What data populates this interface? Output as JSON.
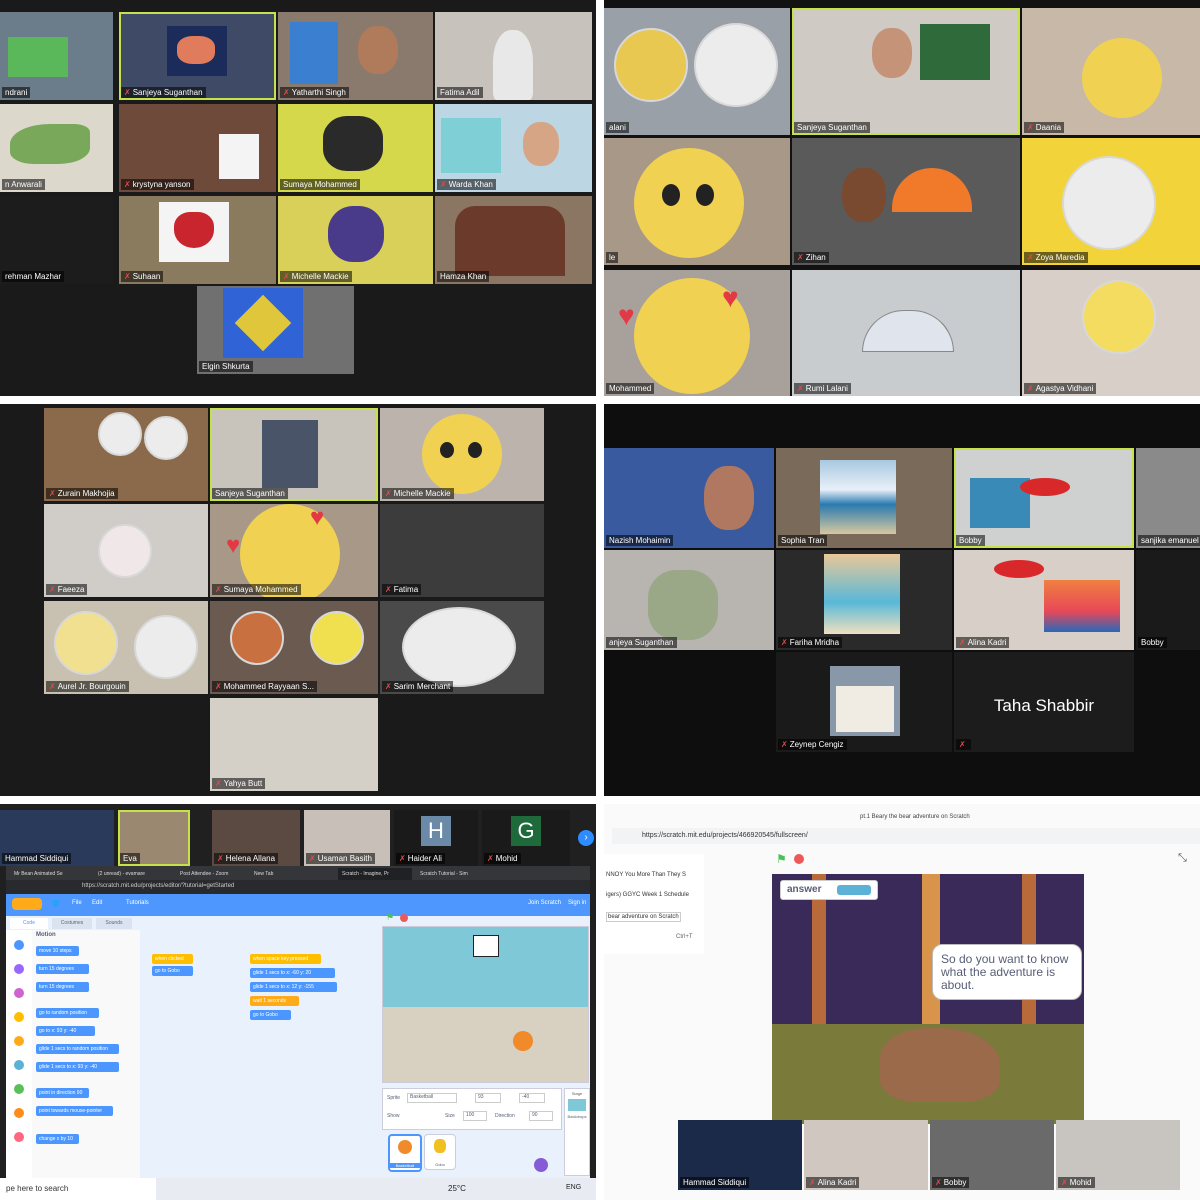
{
  "panel1": {
    "participants": [
      {
        "name": "ndrani"
      },
      {
        "name": "Sanjeya Suganthan"
      },
      {
        "name": "Yatharthi Singh"
      },
      {
        "name": "Fatima Adil"
      },
      {
        "name": "n Anwarali"
      },
      {
        "name": "krystyna yanson"
      },
      {
        "name": "Sumaya Mohammed"
      },
      {
        "name": "Warda Khan"
      },
      {
        "name": "rehman Mazhar"
      },
      {
        "name": "Suhaan"
      },
      {
        "name": "Michelle Mackie"
      },
      {
        "name": "Hamza Khan"
      },
      {
        "name": "Elgin Shkurta"
      }
    ]
  },
  "panel2": {
    "participants": [
      {
        "name": "alani"
      },
      {
        "name": "Sanjeya Suganthan"
      },
      {
        "name": "Daania"
      },
      {
        "name": "le"
      },
      {
        "name": "Zihan"
      },
      {
        "name": "Zoya Maredia"
      },
      {
        "name": "Mohammed"
      },
      {
        "name": "Rumi Lalani"
      },
      {
        "name": "Agastya Vidhani"
      }
    ]
  },
  "panel3": {
    "participants": [
      {
        "name": "Zurain Makhojia"
      },
      {
        "name": "Sanjeya Suganthan"
      },
      {
        "name": "Michelle Mackie"
      },
      {
        "name": "Faeeza"
      },
      {
        "name": "Sumaya Mohammed"
      },
      {
        "name": "Fatima"
      },
      {
        "name": "Aurel Jr. Bourgouin"
      },
      {
        "name": "Mohammed Rayyaan S..."
      },
      {
        "name": "Sarim Merchant"
      },
      {
        "name": "Yahya Butt"
      }
    ]
  },
  "panel4": {
    "participants": [
      {
        "name": "Nazish Mohaimin"
      },
      {
        "name": "Sophia Tran"
      },
      {
        "name": "Bobby"
      },
      {
        "name": "sanjika emanuel su"
      },
      {
        "name": "anjeya Suganthan"
      },
      {
        "name": "Fariha Mridha"
      },
      {
        "name": "Alina Kadri"
      },
      {
        "name": "Bobby"
      },
      {
        "name": "Zeynep Cengiz"
      },
      {
        "name": ""
      }
    ],
    "big_name": "Taha Shabbir"
  },
  "panel5": {
    "participants": [
      {
        "name": "Hammad Siddiqui"
      },
      {
        "name": "Eva"
      },
      {
        "name": "Helena Allana"
      },
      {
        "name": "Usaman Basith"
      },
      {
        "name": "Haider Ali",
        "initial": "H"
      },
      {
        "name": "Mohid",
        "initial": "G"
      }
    ],
    "browser_tabs": [
      "Mr Bean Animated Se",
      "(2 unread) - evamare",
      "Post Attendee - Zoom",
      "New Tab",
      "Scratch - Imagine, Pr",
      "Scratch Tutorial - Sim"
    ],
    "url": "https://scratch.mit.edu/projects/editor/?tutorial=getStarted",
    "menu": [
      "File",
      "Edit",
      "Tutorials",
      "Join Scratch",
      "Sign in"
    ],
    "editor_tabs": [
      "Code",
      "Costumes",
      "Sounds"
    ],
    "category_title": "Motion",
    "categories": [
      "Motion",
      "Looks",
      "Sound",
      "Events",
      "Control",
      "Sensing",
      "Operators",
      "Variables",
      "My Blocks"
    ],
    "palette_blocks": [
      "move 10 steps",
      "turn 15 degrees",
      "turn 15 degrees",
      "go to random position",
      "go to x: 93 y: -40",
      "glide 1 secs to random position",
      "glide 1 secs to x: 93 y: -40",
      "point in direction 90",
      "point towards mouse-pointer",
      "change x by 10"
    ],
    "script1": [
      "when clicked",
      "go to Gobo"
    ],
    "script2": [
      "when space key pressed",
      "glide 1 secs to x: -60 y: 20",
      "glide 1 secs to x: 12 y: -155",
      "wait 1 seconds",
      "go to Gobo"
    ],
    "sprite_info": {
      "sprite_label": "Sprite",
      "sprite_name": "Basketball",
      "x": "93",
      "y": "-40",
      "show_label": "Show",
      "size_label": "Size",
      "size": "100",
      "direction_label": "Direction",
      "direction": "90"
    },
    "sprites": [
      "Basketball",
      "Gobo"
    ],
    "stage_label": "Stage",
    "backdrops_label": "Backdrops",
    "taskbar_search": "pe here to search",
    "weather": "25°C",
    "lang": "ENG"
  },
  "panel6": {
    "tab_title": "pt.1 Beary the bear adventure on Scratch",
    "url": "https://scratch.mit.edu/projects/466920545/fullscreen/",
    "sidebar_items": [
      "NNOY You More Than They S",
      "igers) GGYC Week 1 Schedule",
      "bear adventure on Scratch"
    ],
    "shortcut": "Ctrl+T",
    "answer_label": "answer",
    "speech": "So do you want to know what the adventure is about.",
    "thumbnails": [
      {
        "name": "Hammad Siddiqui"
      },
      {
        "name": "Alina Kadri"
      },
      {
        "name": "Bobby"
      },
      {
        "name": "Mohid"
      }
    ]
  }
}
